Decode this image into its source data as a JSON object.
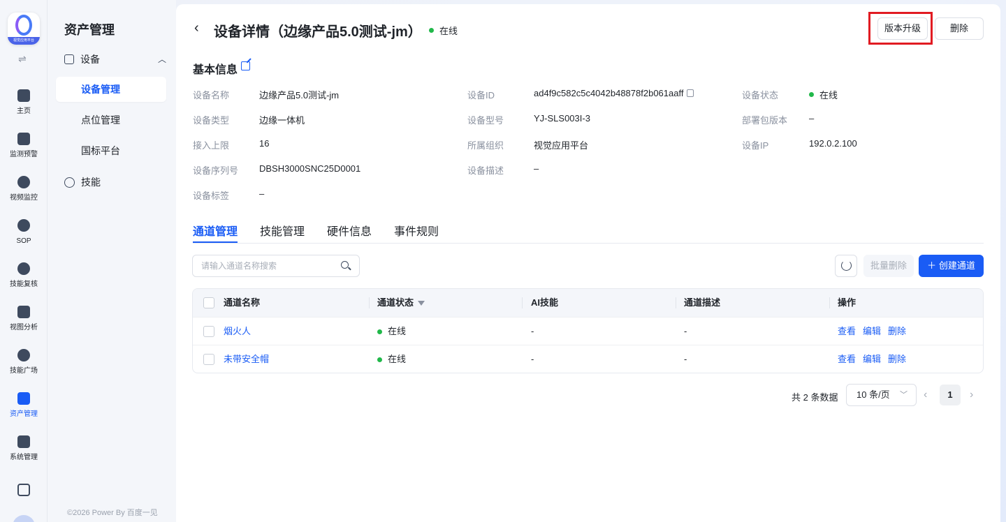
{
  "rail": {
    "logo_caption": "视觉应用平台",
    "items": [
      {
        "label": "主页",
        "icon": "home-icon"
      },
      {
        "label": "监测预警",
        "icon": "chart-icon"
      },
      {
        "label": "视频监控",
        "icon": "camera-icon"
      },
      {
        "label": "SOP",
        "icon": "sop-icon"
      },
      {
        "label": "技能复核",
        "icon": "review-icon"
      },
      {
        "label": "视图分析",
        "icon": "image-analysis-icon"
      },
      {
        "label": "技能广场",
        "icon": "skill-square-icon"
      },
      {
        "label": "资产管理",
        "icon": "asset-icon",
        "active": true
      },
      {
        "label": "系统管理",
        "icon": "system-icon"
      }
    ]
  },
  "sidebar": {
    "title": "资产管理",
    "group_label": "设备",
    "items": [
      "设备管理",
      "点位管理",
      "国标平台"
    ],
    "skill_label": "技能",
    "footer": "©2026 Power By 百度一见"
  },
  "header": {
    "title": "设备详情（边缘产品5.0测试-jm）",
    "status": "在线",
    "upgrade_button": "版本升级",
    "delete_button": "删除"
  },
  "basic_info": {
    "title": "基本信息",
    "fields": [
      {
        "label": "设备名称",
        "value": "边缘产品5.0测试-jm"
      },
      {
        "label": "设备ID",
        "value": "ad4f9c582c5c4042b48878f2b061aaff"
      },
      {
        "label": "设备状态",
        "value": "在线"
      },
      {
        "label": "设备类型",
        "value": "边缘一体机"
      },
      {
        "label": "设备型号",
        "value": "YJ-SLS003I-3"
      },
      {
        "label": "部署包版本",
        "value": "–"
      },
      {
        "label": "接入上限",
        "value": "16"
      },
      {
        "label": "所属组织",
        "value": "视觉应用平台"
      },
      {
        "label": "设备IP",
        "value": "192.0.2.100"
      },
      {
        "label": "设备序列号",
        "value": "DBSH3000SNC25D0001"
      },
      {
        "label": "设备描述",
        "value": "–"
      },
      {
        "label": "设备标签",
        "value": "–"
      }
    ]
  },
  "tabs": [
    "通道管理",
    "技能管理",
    "硬件信息",
    "事件规则"
  ],
  "toolbar": {
    "search_placeholder": "请输入通道名称搜索",
    "batch_delete": "批量删除",
    "create_channel": "创建通道"
  },
  "table": {
    "columns": [
      "通道名称",
      "通道状态",
      "AI技能",
      "通道描述",
      "操作"
    ],
    "rows": [
      {
        "name": "烟火人",
        "status": "在线",
        "ai_skill": "-",
        "description": "-"
      },
      {
        "name": "未带安全帽",
        "status": "在线",
        "ai_skill": "-",
        "description": "-"
      }
    ],
    "actions": [
      "查看",
      "编辑",
      "删除"
    ]
  },
  "pagination": {
    "total_text": "共 2 条数据",
    "page_size": "10 条/页",
    "current_page": "1"
  },
  "colors": {
    "accent": "#1a5cf5",
    "online": "#21b84a",
    "highlight_box": "#e11b22"
  }
}
